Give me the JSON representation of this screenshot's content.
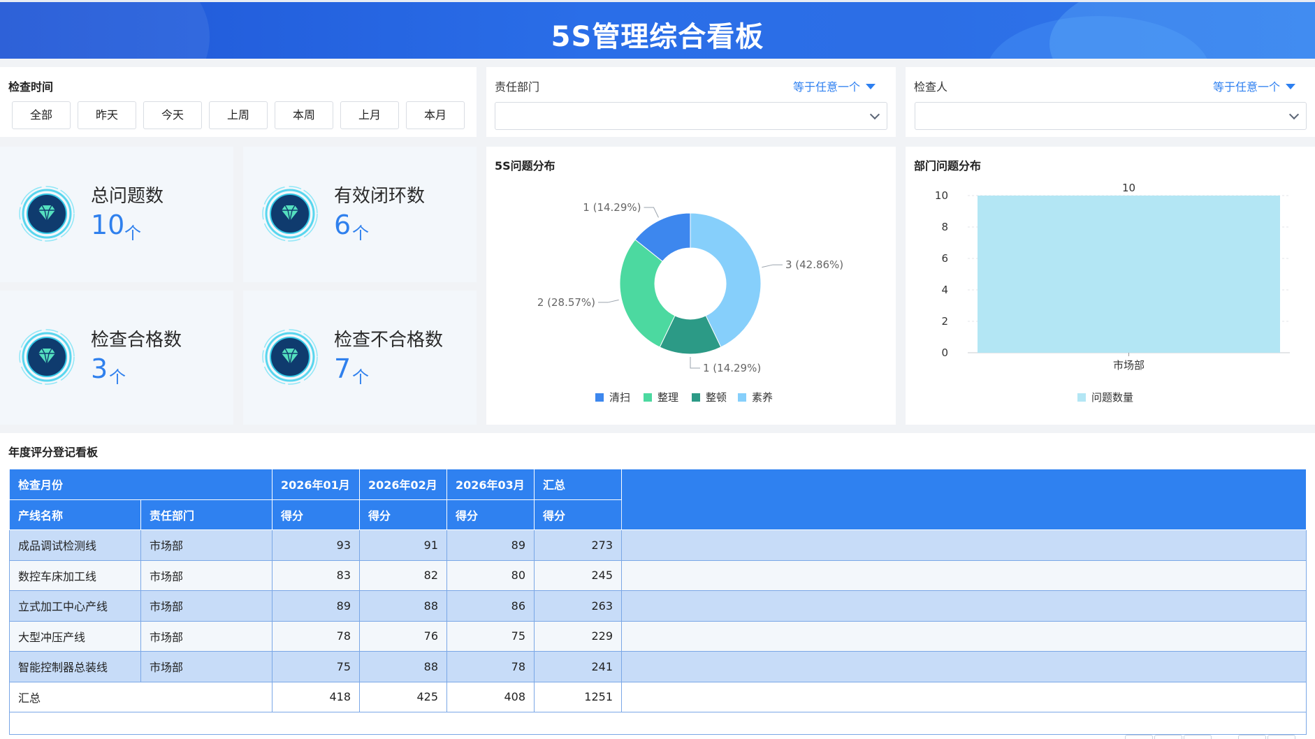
{
  "header": {
    "title": "5S管理综合看板"
  },
  "filters": {
    "time": {
      "label": "检查时间",
      "buttons": [
        "全部",
        "昨天",
        "今天",
        "上周",
        "本周",
        "上月",
        "本月"
      ]
    },
    "department": {
      "label": "责任部门",
      "condition": "等于任意一个",
      "value": ""
    },
    "inspector": {
      "label": "检查人",
      "condition": "等于任意一个",
      "value": ""
    }
  },
  "kpis": [
    {
      "title": "总问题数",
      "value": "10",
      "unit": "个",
      "icon": "diamond-icon"
    },
    {
      "title": "有效闭环数",
      "value": "6",
      "unit": "个",
      "icon": "diamond-icon"
    },
    {
      "title": "检查合格数",
      "value": "3",
      "unit": "个",
      "icon": "diamond-icon"
    },
    {
      "title": "检查不合格数",
      "value": "7",
      "unit": "个",
      "icon": "diamond-icon"
    }
  ],
  "chart_data": [
    {
      "type": "pie",
      "title": "5S问题分布",
      "donut": true,
      "categories": [
        "清扫",
        "整理",
        "整顿",
        "素养"
      ],
      "values": [
        1,
        2,
        1,
        3
      ],
      "labels": [
        "1 (14.29%)",
        "2 (28.57%)",
        "1 (14.29%)",
        "3 (42.86%)"
      ],
      "colors": [
        "#3d87ee",
        "#4cd9a0",
        "#2c9a86",
        "#86cffb"
      ],
      "legend": "bottom"
    },
    {
      "type": "bar",
      "title": "部门问题分布",
      "categories": [
        "市场部"
      ],
      "series": [
        {
          "name": "问题数量",
          "values": [
            10
          ]
        }
      ],
      "data_labels": [
        "10"
      ],
      "yticks": [
        "0",
        "2",
        "4",
        "6",
        "8",
        "10"
      ],
      "ylim": [
        0,
        10
      ],
      "color": "#b3e6f4",
      "legend": "bottom"
    }
  ],
  "table": {
    "title": "年度评分登记看板",
    "header1": [
      "检查月份",
      "2026年01月",
      "2026年02月",
      "2026年03月",
      "汇总"
    ],
    "header2": [
      "产线名称",
      "责任部门",
      "得分",
      "得分",
      "得分",
      "得分"
    ],
    "rows": [
      [
        "成品调试检测线",
        "市场部",
        "93",
        "91",
        "89",
        "273"
      ],
      [
        "数控车床加工线",
        "市场部",
        "83",
        "82",
        "80",
        "245"
      ],
      [
        "立式加工中心产线",
        "市场部",
        "89",
        "88",
        "86",
        "263"
      ],
      [
        "大型冲压产线",
        "市场部",
        "78",
        "76",
        "75",
        "229"
      ],
      [
        "智能控制器总装线",
        "市场部",
        "75",
        "88",
        "78",
        "241"
      ]
    ],
    "total": [
      "汇总",
      "418",
      "425",
      "408",
      "1251"
    ]
  }
}
